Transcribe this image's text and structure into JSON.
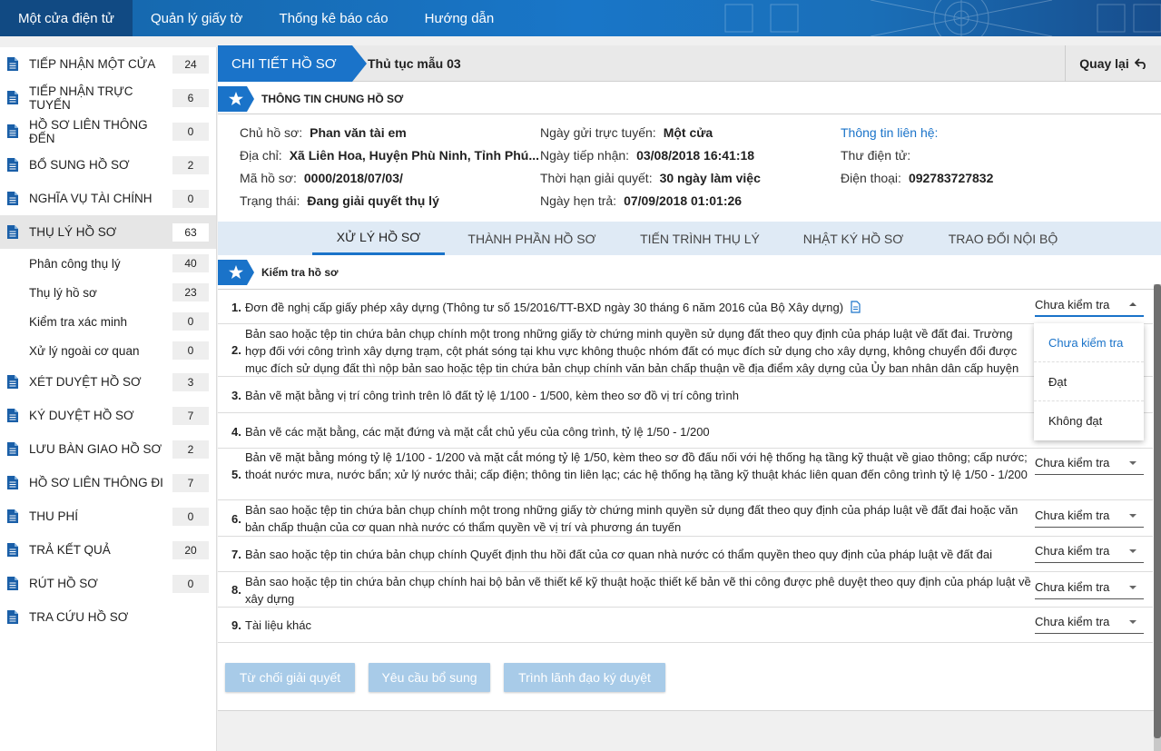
{
  "topnav": {
    "items": [
      "Một cửa điện tử",
      "Quản lý giấy tờ",
      "Thống kê báo cáo",
      "Hướng dẫn"
    ]
  },
  "sidebar": {
    "items": [
      {
        "label": "Tiếp nhận một cửa",
        "count": "24"
      },
      {
        "label": "Tiếp nhận trực tuyến",
        "count": "6"
      },
      {
        "label": "Hồ sơ liên thông đến",
        "count": "0"
      },
      {
        "label": "Bổ sung hồ sơ",
        "count": "2"
      },
      {
        "label": "Nghĩa vụ tài chính",
        "count": "0"
      },
      {
        "label": "Thụ lý hồ sơ",
        "count": "63"
      },
      {
        "label": "Xét duyệt hồ sơ",
        "count": "3"
      },
      {
        "label": "Ký duyệt hồ sơ",
        "count": "7"
      },
      {
        "label": "Lưu bàn giao hồ sơ",
        "count": "2"
      },
      {
        "label": "Hồ sơ liên thông đi",
        "count": "7"
      },
      {
        "label": "Thu phí",
        "count": "0"
      },
      {
        "label": "Trả kết quả",
        "count": "20"
      },
      {
        "label": "Rút hồ sơ",
        "count": "0"
      },
      {
        "label": "Tra cứu hồ sơ",
        "count": ""
      }
    ],
    "subitems": [
      {
        "label": "Phân công thụ lý",
        "count": "40"
      },
      {
        "label": "Thụ lý hồ sơ",
        "count": "23"
      },
      {
        "label": "Kiểm tra xác minh",
        "count": "0"
      },
      {
        "label": "Xử lý ngoài cơ quan",
        "count": "0"
      }
    ]
  },
  "header": {
    "crumb": "CHI TIẾT HỒ SƠ",
    "procedure": "Thủ tục mẫu 03",
    "back": "Quay lại"
  },
  "general": {
    "title": "THÔNG TIN CHUNG HỒ SƠ",
    "owner_k": "Chủ hồ sơ:",
    "owner_v": "Phan văn tài em",
    "address_k": "Địa chỉ:",
    "address_v": "Xã Liên Hoa, Huyện Phù Ninh, Tỉnh Phú...",
    "code_k": "Mã hồ sơ:",
    "code_v": "0000/2018/07/03/",
    "status_k": "Trạng thái:",
    "status_v": "Đang giải quyết thụ lý",
    "sent_k": "Ngày gửi trực tuyến:",
    "sent_v": "Một cửa",
    "received_k": "Ngày tiếp nhận:",
    "received_v": "03/08/2018 16:41:18",
    "deadline_k": "Thời hạn giải quyết:",
    "deadline_v": "30 ngày làm việc",
    "due_k": "Ngày hẹn trả:",
    "due_v": "07/09/2018 01:01:26",
    "contact_title": "Thông tin liên hệ:",
    "email_k": "Thư điện tử:",
    "email_v": "",
    "phone_k": "Điện thoại:",
    "phone_v": "092783727832"
  },
  "tabs": [
    "XỬ LÝ HỒ SƠ",
    "THÀNH PHẦN HỒ SƠ",
    "TIẾN TRÌNH THỤ LÝ",
    "NHẬT KÝ HỒ SƠ",
    "TRAO ĐỔI NỘI BỘ"
  ],
  "check": {
    "title": "Kiểm tra hồ sơ",
    "items": [
      {
        "num": "1.",
        "text": "Đơn đề nghị cấp giấy phép xây dựng (Thông tư số 15/2016/TT-BXD ngày 30 tháng 6 năm 2016 của Bộ Xây dựng)",
        "status": "Chưa kiểm tra"
      },
      {
        "num": "2.",
        "text": "Bản sao hoặc tệp tin chứa bản chụp chính một trong những giấy tờ chứng minh quyền sử dụng đất theo quy định của pháp luật về đất đai. Trường hợp đối với công trình xây dựng trạm, cột phát sóng tại khu vực không thuộc nhóm đất có mục đích sử dụng cho xây dựng, không chuyển đổi được mục đích sử dụng đất thì nộp bản sao hoặc tệp tin chứa bản chụp chính văn bản chấp thuận về địa điểm xây dựng của Ủy ban nhân dân cấp huyện",
        "status": ""
      },
      {
        "num": "3.",
        "text": "Bản vẽ mặt bằng vị trí công trình trên lô đất tỷ lệ 1/100 - 1/500, kèm theo sơ đồ vị trí công trình",
        "status": ""
      },
      {
        "num": "4.",
        "text": "Bản vẽ các mặt bằng, các mặt đứng và mặt cắt chủ yếu của công trình, tỷ lệ 1/50 - 1/200",
        "status": ""
      },
      {
        "num": "5.",
        "text": "Bản vẽ mặt bằng móng tỷ lệ 1/100 - 1/200 và mặt cắt móng tỷ lệ 1/50, kèm theo sơ đồ đấu nối với hệ thống hạ tầng kỹ thuật về giao thông; cấp nước; thoát nước mưa, nước bẩn; xử lý nước thải; cấp điện; thông tin liên lạc; các hệ thống hạ tầng kỹ thuật khác liên quan đến công trình tỷ lệ 1/50 - 1/200",
        "status": "Chưa kiểm tra"
      },
      {
        "num": "6.",
        "text": "Bản sao hoặc tệp tin chứa bản chụp chính một trong những giấy tờ chứng minh quyền sử dụng đất theo quy định của pháp luật về đất đai hoặc văn bản chấp thuận của cơ quan nhà nước có thẩm quyền về vị trí và phương án tuyến",
        "status": "Chưa kiểm tra"
      },
      {
        "num": "7.",
        "text": "Bản sao hoặc tệp tin chứa bản chụp chính Quyết định thu hồi đất của cơ quan nhà nước có thẩm quyền theo quy định của pháp luật về đất đai",
        "status": "Chưa kiểm tra"
      },
      {
        "num": "8.",
        "text": "Bản sao hoặc tệp tin chứa bản chụp chính hai bộ bản vẽ thiết kế kỹ thuật hoặc thiết kế bản vẽ thi công được phê duyệt theo quy định của pháp luật về xây dựng",
        "status": "Chưa kiểm tra"
      },
      {
        "num": "9.",
        "text": "Tài liệu khác",
        "status": "Chưa kiểm tra"
      }
    ],
    "dropdown_options": [
      "Chưa kiểm tra",
      "Đạt",
      "Không đạt"
    ]
  },
  "actions": {
    "reject": "Từ chối giải quyết",
    "request": "Yêu cầu bổ sung",
    "submit": "Trình lãnh đạo ký duyệt"
  }
}
